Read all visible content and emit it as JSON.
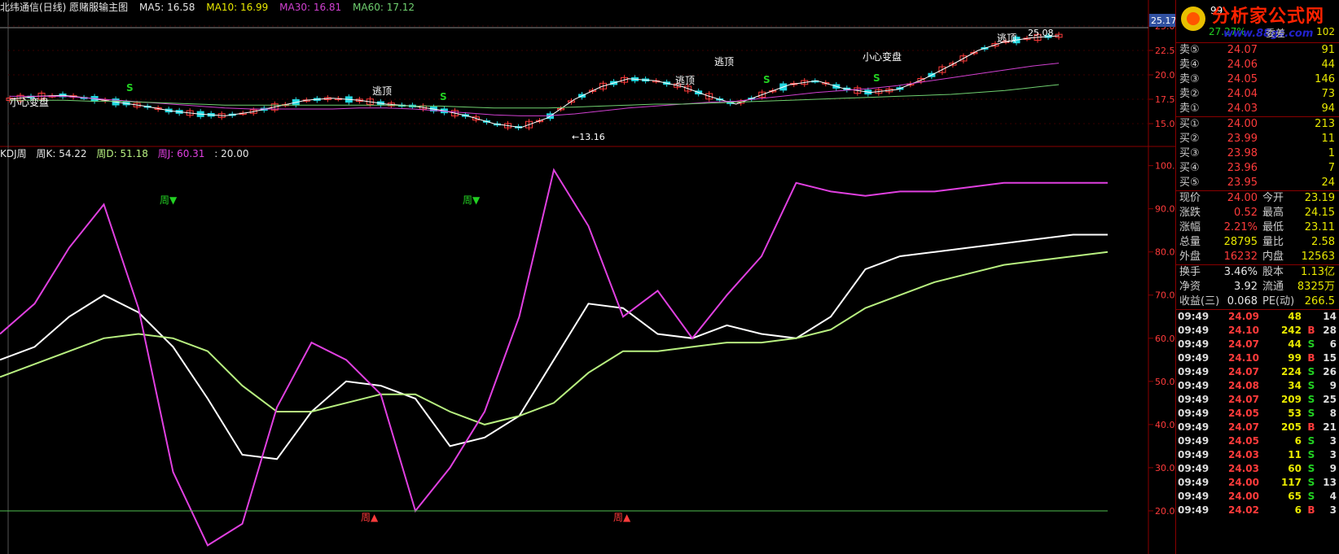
{
  "price_header": {
    "title": "北纬通信(日线) 愿赌服输主图",
    "ma5": "MA5: 16.58",
    "ma10": "MA10: 16.99",
    "ma30": "MA30: 16.81",
    "ma60": "MA60: 17.12"
  },
  "kdj_header": {
    "title": "KDJ周",
    "k": "周K: 54.22",
    "d": "周D: 51.18",
    "j": "周J: 60.31",
    "line": ": 20.00"
  },
  "price_axis": [
    "25.00",
    "22.50",
    "20.00",
    "17.50",
    "15.00"
  ],
  "price_current_tag": "25.17",
  "kdj_axis": [
    "100.0",
    "90.00",
    "80.00",
    "70.00",
    "60.00",
    "50.00",
    "40.00",
    "30.00",
    "20.00"
  ],
  "annotations": {
    "xiaoxin_1": "小心变盘",
    "xiaoxin_2": "小心变盘",
    "taoding_1": "逃顶",
    "taoding_2": "逃顶",
    "taoding_3": "逃顶",
    "taoding_4": "逃顶",
    "low_label": "←13.16",
    "high_label": "25.08",
    "s_mark": "S",
    "week_sell": "周▼",
    "week_buy": "周▲"
  },
  "watermark": {
    "title": "分析家公式网",
    "url": "www.88gs.com",
    "corner": "99",
    "pct": "27.27%",
    "xx": "委差",
    "num": "102"
  },
  "colors": {
    "up": "#ff3b3b",
    "down": "#22d8e0",
    "k": "#ffffff",
    "d": "#b8f080",
    "j": "#e040e0",
    "ma30": "#d040d0",
    "ma60": "#70d070"
  },
  "chart_data": [
    {
      "type": "line",
      "title": "北纬通信(日线) 愿赌服输主图",
      "ylim": [
        13,
        26
      ],
      "series": [
        {
          "name": "MA5",
          "values": [
            17.5,
            17.8,
            17.9,
            17.6,
            17.2,
            16.8,
            16.3,
            16.0,
            15.8,
            16.2,
            16.8,
            17.4,
            17.6,
            17.4,
            17.0,
            16.8,
            16.4,
            15.8,
            15.0,
            14.6,
            15.6,
            17.5,
            18.8,
            19.6,
            19.4,
            18.8,
            17.8,
            17.0,
            18.0,
            19.0,
            19.4,
            18.6,
            18.2,
            18.5,
            19.6,
            21.0,
            22.5,
            23.4,
            23.8,
            24.0
          ]
        },
        {
          "name": "MA30",
          "values": [
            17.8,
            17.8,
            17.8,
            17.6,
            17.4,
            17.2,
            17.0,
            16.8,
            16.6,
            16.5,
            16.5,
            16.5,
            16.5,
            16.6,
            16.6,
            16.5,
            16.3,
            16.1,
            15.9,
            15.8,
            15.8,
            16.0,
            16.3,
            16.6,
            16.8,
            17.0,
            17.2,
            17.3,
            17.6,
            17.9,
            18.2,
            18.4,
            18.6,
            18.9,
            19.3,
            19.7,
            20.1,
            20.5,
            20.9,
            21.2
          ]
        },
        {
          "name": "MA60",
          "values": [
            17.4,
            17.4,
            17.4,
            17.3,
            17.3,
            17.2,
            17.1,
            17.0,
            16.9,
            16.9,
            16.9,
            16.9,
            16.9,
            16.9,
            16.9,
            16.8,
            16.8,
            16.7,
            16.6,
            16.6,
            16.6,
            16.7,
            16.8,
            16.9,
            17.0,
            17.0,
            17.1,
            17.2,
            17.3,
            17.4,
            17.5,
            17.6,
            17.7,
            17.8,
            17.9,
            18.0,
            18.2,
            18.4,
            18.7,
            19.0
          ]
        }
      ]
    },
    {
      "type": "line",
      "title": "KDJ周",
      "ylim": [
        10,
        102
      ],
      "x": [
        0,
        1,
        2,
        3,
        4,
        5,
        6,
        7,
        8,
        9,
        10,
        11,
        12,
        13,
        14,
        15,
        16,
        17,
        18,
        19,
        20,
        21,
        22,
        23,
        24,
        25,
        26,
        27,
        28,
        29,
        30,
        31,
        32
      ],
      "series": [
        {
          "name": "周K",
          "values": [
            55,
            58,
            65,
            70,
            66,
            58,
            46,
            33,
            32,
            43,
            50,
            49,
            46,
            35,
            37,
            42,
            55,
            68,
            67,
            61,
            60,
            63,
            61,
            60,
            65,
            76,
            79,
            80,
            81,
            82,
            83,
            84,
            84
          ]
        },
        {
          "name": "周D",
          "values": [
            51,
            54,
            57,
            60,
            61,
            60,
            57,
            49,
            43,
            43,
            45,
            47,
            47,
            43,
            40,
            42,
            45,
            52,
            57,
            57,
            58,
            59,
            59,
            60,
            62,
            67,
            70,
            73,
            75,
            77,
            78,
            79,
            80
          ]
        },
        {
          "name": "周J",
          "values": [
            61,
            68,
            81,
            91,
            67,
            29,
            12,
            17,
            44,
            59,
            55,
            47,
            20,
            30,
            43,
            65,
            99,
            86,
            65,
            71,
            60,
            70,
            79,
            96,
            94,
            93,
            94,
            94,
            95,
            96,
            96,
            96,
            96
          ]
        },
        {
          "name": "20.00",
          "values": [
            20,
            20,
            20,
            20,
            20,
            20,
            20,
            20,
            20,
            20,
            20,
            20,
            20,
            20,
            20,
            20,
            20,
            20,
            20,
            20,
            20,
            20,
            20,
            20,
            20,
            20,
            20,
            20,
            20,
            20,
            20,
            20,
            20
          ]
        }
      ]
    }
  ],
  "quote": {
    "asks": [
      {
        "label": "卖⑤",
        "price": "24.07",
        "vol": "91"
      },
      {
        "label": "卖④",
        "price": "24.06",
        "vol": "44"
      },
      {
        "label": "卖③",
        "price": "24.05",
        "vol": "146"
      },
      {
        "label": "卖②",
        "price": "24.04",
        "vol": "73"
      },
      {
        "label": "卖①",
        "price": "24.03",
        "vol": "94"
      }
    ],
    "bids": [
      {
        "label": "买①",
        "price": "24.00",
        "vol": "213"
      },
      {
        "label": "买②",
        "price": "23.99",
        "vol": "11"
      },
      {
        "label": "买③",
        "price": "23.98",
        "vol": "1"
      },
      {
        "label": "买④",
        "price": "23.96",
        "vol": "7"
      },
      {
        "label": "买⑤",
        "price": "23.95",
        "vol": "24"
      }
    ],
    "stats1": [
      {
        "l1": "现价",
        "v1": "24.00",
        "c1": "red",
        "l2": "今开",
        "v2": "23.19",
        "c2": "green"
      },
      {
        "l1": "涨跌",
        "v1": "0.52",
        "c1": "red",
        "l2": "最高",
        "v2": "24.15",
        "c2": "red"
      },
      {
        "l1": "涨幅",
        "v1": "2.21%",
        "c1": "red",
        "l2": "最低",
        "v2": "23.11",
        "c2": "green"
      },
      {
        "l1": "总量",
        "v1": "28795",
        "c1": "yellow",
        "l2": "量比",
        "v2": "2.58",
        "c2": "red"
      },
      {
        "l1": "外盘",
        "v1": "16232",
        "c1": "red",
        "l2": "内盘",
        "v2": "12563",
        "c2": "green"
      }
    ],
    "stats2": [
      {
        "l1": "换手",
        "v1": "3.46%",
        "c1": "white",
        "l2": "股本",
        "v2": "1.13亿",
        "c2": "white"
      },
      {
        "l1": "净资",
        "v1": "3.92",
        "c1": "white",
        "l2": "流通",
        "v2": "8325万",
        "c2": "white"
      },
      {
        "l1": "收益(三)",
        "v1": "0.068",
        "c1": "white",
        "l2": "PE(动)",
        "v2": "266.5",
        "c2": "white"
      }
    ],
    "ticks": [
      {
        "time": "09:49",
        "price": "24.09",
        "pc": "red",
        "vol": "48",
        "bs": "",
        "n": "14"
      },
      {
        "time": "09:49",
        "price": "24.10",
        "pc": "red",
        "vol": "242",
        "bs": "B",
        "n": "28"
      },
      {
        "time": "09:49",
        "price": "24.07",
        "pc": "red",
        "vol": "44",
        "bs": "S",
        "n": "6"
      },
      {
        "time": "09:49",
        "price": "24.10",
        "pc": "red",
        "vol": "99",
        "bs": "B",
        "n": "15"
      },
      {
        "time": "09:49",
        "price": "24.07",
        "pc": "red",
        "vol": "224",
        "bs": "S",
        "n": "26"
      },
      {
        "time": "09:49",
        "price": "24.08",
        "pc": "red",
        "vol": "34",
        "bs": "S",
        "n": "9"
      },
      {
        "time": "09:49",
        "price": "24.07",
        "pc": "red",
        "vol": "209",
        "bs": "S",
        "n": "25"
      },
      {
        "time": "09:49",
        "price": "24.05",
        "pc": "red",
        "vol": "53",
        "bs": "S",
        "n": "8"
      },
      {
        "time": "09:49",
        "price": "24.07",
        "pc": "red",
        "vol": "205",
        "bs": "B",
        "n": "21"
      },
      {
        "time": "09:49",
        "price": "24.05",
        "pc": "red",
        "vol": "6",
        "bs": "S",
        "n": "3"
      },
      {
        "time": "09:49",
        "price": "24.03",
        "pc": "red",
        "vol": "11",
        "bs": "S",
        "n": "3"
      },
      {
        "time": "09:49",
        "price": "24.03",
        "pc": "red",
        "vol": "60",
        "bs": "S",
        "n": "9"
      },
      {
        "time": "09:49",
        "price": "24.00",
        "pc": "red",
        "vol": "117",
        "bs": "S",
        "n": "13"
      },
      {
        "time": "09:49",
        "price": "24.00",
        "pc": "red",
        "vol": "65",
        "bs": "S",
        "n": "4"
      },
      {
        "time": "09:49",
        "price": "24.02",
        "pc": "red",
        "vol": "6",
        "bs": "B",
        "n": "3"
      }
    ]
  }
}
